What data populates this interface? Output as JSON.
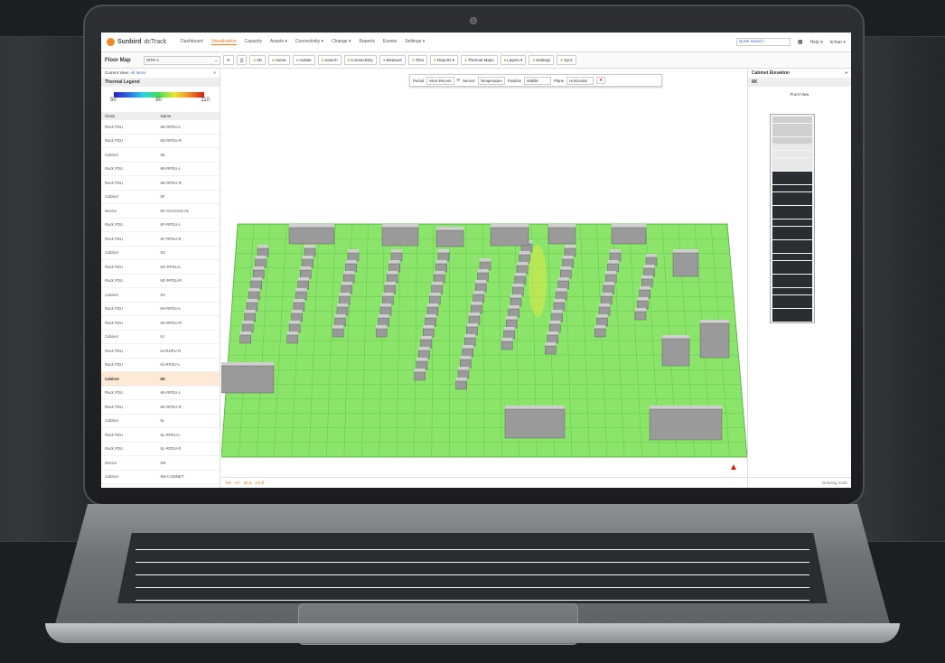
{
  "app": {
    "brand": "Sunbird",
    "product": "dcTrack"
  },
  "nav": {
    "items": [
      "Dashboard",
      "Visualization",
      "Capacity",
      "Assets ▾",
      "Connectivity ▾",
      "Change ▾",
      "Reports",
      "Events",
      "Settings ▾"
    ],
    "active": 1,
    "search_placeholder": "Quick Search...",
    "help": "Help ▾",
    "user": "kchan ▾"
  },
  "toolbar": {
    "title": "Floor Map",
    "site": "SITE A",
    "buttons": [
      "3D",
      "Home",
      "Isolate",
      "Search",
      "Connectivity",
      "Measure",
      "Tiles",
      "Reports ▾",
      "Thermal Maps",
      "Layers ▾",
      "Settings",
      "Sync"
    ]
  },
  "sidebar": {
    "current_view_label": "Current View:",
    "current_view_value": "All Items",
    "legend_title": "Thermal Legend",
    "legend_ticks": [
      "50",
      "80",
      "110"
    ],
    "col_class": "Class",
    "col_name": "Name",
    "rows": [
      [
        "Rack PDU",
        "6D-RPDU-L"
      ],
      [
        "Rack PDU",
        "6D-RPDU-R"
      ],
      [
        "Cabinet",
        "6E"
      ],
      [
        "Rack PDU",
        "6E-RPDU-L"
      ],
      [
        "Rack PDU",
        "6E-RPDU-R"
      ],
      [
        "Cabinet",
        "6F"
      ],
      [
        "Device",
        "6F-CHASSIS-01"
      ],
      [
        "Rack PDU",
        "6F-RPDU-L"
      ],
      [
        "Rack PDU",
        "6F-RPDU-R"
      ],
      [
        "Cabinet",
        "6G"
      ],
      [
        "Rack PDU",
        "6G-RPDU-L"
      ],
      [
        "Rack PDU",
        "6G-RPDU-R"
      ],
      [
        "Cabinet",
        "6H"
      ],
      [
        "Rack PDU",
        "6H-RPDU-L"
      ],
      [
        "Rack PDU",
        "6H-RPDU-R"
      ],
      [
        "Cabinet",
        "6J"
      ],
      [
        "Rack PDU",
        "6J-RDPU-R"
      ],
      [
        "Rack PDU",
        "6J-RPDU-L"
      ],
      [
        "Cabinet",
        "6K"
      ],
      [
        "Rack PDU",
        "6K-RPDU-L"
      ],
      [
        "Rack PDU",
        "6K-RPDU-R"
      ],
      [
        "Cabinet",
        "6L"
      ],
      [
        "Rack PDU",
        "6L-RPDU-L"
      ],
      [
        "Rack PDU",
        "6L-RPDU-R"
      ],
      [
        "Device",
        "6M"
      ],
      [
        "Cabinet",
        "6M-CABINET"
      ]
    ],
    "selected_index": 18
  },
  "filter": {
    "period_label": "Period",
    "period": "Most Recent",
    "sensor_label": "Sensor",
    "sensor": "Temperature",
    "position_label": "Position",
    "position": "Middle",
    "plane_label": "Plane",
    "plane": "Horizontal"
  },
  "elevation": {
    "title": "Cabinet Elevation",
    "cabinet": "6K",
    "view": "Front View"
  },
  "status": {
    "tile_label": "Tile",
    "tile_value": "6Y",
    "coord": "62.5, -3.6 ft",
    "drawing": "Drawing north"
  }
}
